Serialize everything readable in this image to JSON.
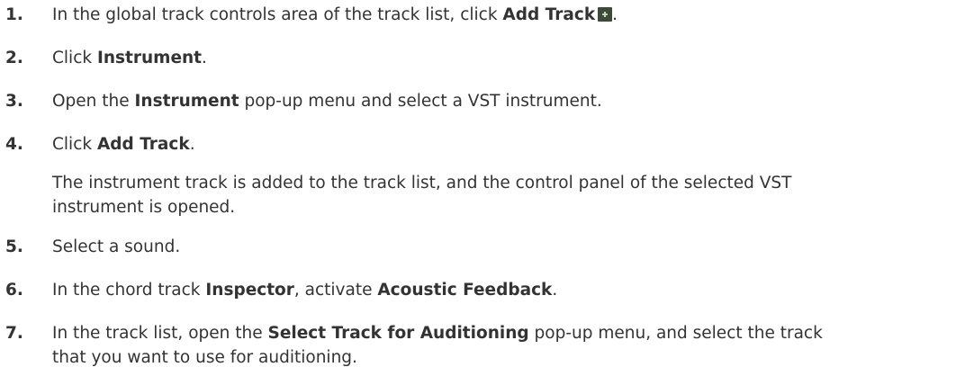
{
  "steps": [
    {
      "number": "1.",
      "pre": "In the global track controls area of the track list, click ",
      "bold1": "Add Track",
      "post": ".",
      "icon": "add-track-plus-icon"
    },
    {
      "number": "2.",
      "pre": "Click ",
      "bold1": "Instrument",
      "post": "."
    },
    {
      "number": "3.",
      "pre": "Open the ",
      "bold1": "Instrument",
      "post": " pop-up menu and select a VST instrument."
    },
    {
      "number": "4.",
      "pre": "Click ",
      "bold1": "Add Track",
      "post": ".",
      "result_line1": "The instrument track is added to the track list, and the control panel of the selected VST",
      "result_line2": "instrument is opened."
    },
    {
      "number": "5.",
      "text": "Select a sound."
    },
    {
      "number": "6.",
      "pre": "In the chord track ",
      "bold1": "Inspector",
      "mid": ", activate ",
      "bold2": "Acoustic Feedback",
      "post": "."
    },
    {
      "number": "7.",
      "pre": "In the track list, open the ",
      "bold1": "Select Track for Auditioning",
      "post": " pop-up menu, and select the track",
      "line2": "that you want to use for auditioning."
    }
  ],
  "colors": {
    "text": "#333333",
    "icon_bg": "#3d4a3a",
    "icon_plus": "#b9d7a8"
  }
}
